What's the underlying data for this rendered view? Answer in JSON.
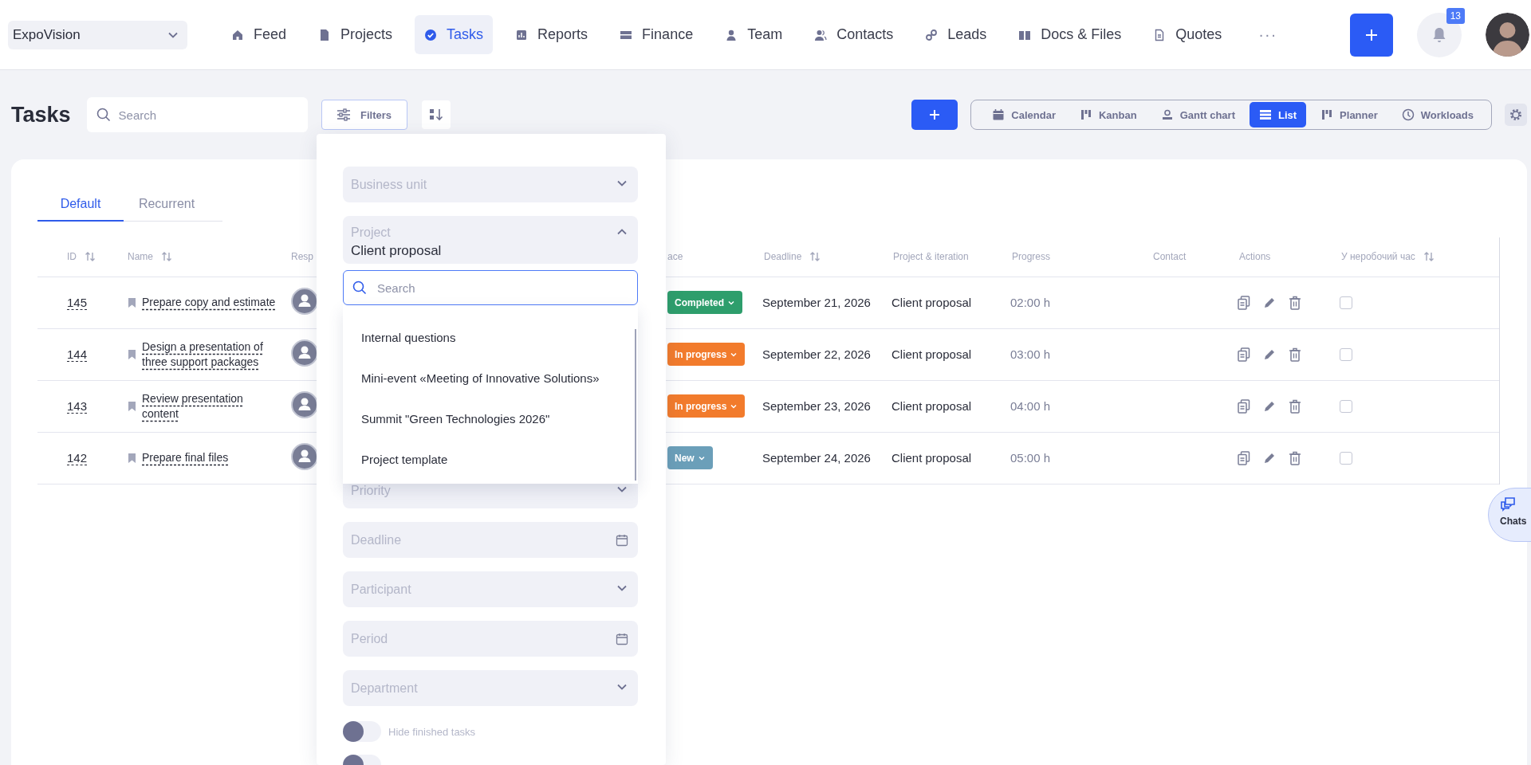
{
  "workspace": {
    "name": "ExpoVision"
  },
  "nav": [
    {
      "label": "Feed",
      "selected": false
    },
    {
      "label": "Projects",
      "selected": false
    },
    {
      "label": "Tasks",
      "selected": true
    },
    {
      "label": "Reports",
      "selected": false
    },
    {
      "label": "Finance",
      "selected": false
    },
    {
      "label": "Team",
      "selected": false
    },
    {
      "label": "Contacts",
      "selected": false
    },
    {
      "label": "Leads",
      "selected": false
    },
    {
      "label": "Docs & Files",
      "selected": false
    },
    {
      "label": "Quotes",
      "selected": false
    }
  ],
  "more": "···",
  "notifications": {
    "count": "13"
  },
  "page": {
    "title": "Tasks",
    "search_placeholder": "Search",
    "filters_label": "Filters"
  },
  "views": [
    {
      "label": "Calendar",
      "selected": false
    },
    {
      "label": "Kanban",
      "selected": false
    },
    {
      "label": "Gantt chart",
      "selected": false
    },
    {
      "label": "List",
      "selected": true
    },
    {
      "label": "Planner",
      "selected": false
    },
    {
      "label": "Workloads",
      "selected": false
    }
  ],
  "tabs": [
    {
      "label": "Default",
      "selected": true
    },
    {
      "label": "Recurrent",
      "selected": false
    }
  ],
  "table": {
    "columns": [
      {
        "label": "ID",
        "sortable": true
      },
      {
        "label": "Name",
        "sortable": true
      },
      {
        "label": "Resp",
        "sortable": false
      },
      {
        "label": "ace",
        "sortable": false
      },
      {
        "label": "Deadline",
        "sortable": true
      },
      {
        "label": "Project & iteration",
        "sortable": false
      },
      {
        "label": "Progress",
        "sortable": false
      },
      {
        "label": "Contact",
        "sortable": false
      },
      {
        "label": "Actions",
        "sortable": false
      },
      {
        "label": "У неробочий час",
        "sortable": true
      }
    ],
    "rows": [
      {
        "id": "145",
        "name": "Prepare copy and estimate",
        "status": {
          "label": "Completed",
          "kind": "completed"
        },
        "deadline": "September 21, 2026",
        "project": "Client proposal",
        "progress": "02:00 h",
        "after_hours": false
      },
      {
        "id": "144",
        "name": "Design a presentation of three support packages",
        "status": {
          "label": "In progress",
          "kind": "in_progress"
        },
        "deadline": "September 22, 2026",
        "project": "Client proposal",
        "progress": "03:00 h",
        "after_hours": false
      },
      {
        "id": "143",
        "name": "Review presentation content",
        "status": {
          "label": "In progress",
          "kind": "in_progress"
        },
        "deadline": "September 23, 2026",
        "project": "Client proposal",
        "progress": "04:00 h",
        "after_hours": false
      },
      {
        "id": "142",
        "name": "Prepare final files",
        "status": {
          "label": "New",
          "kind": "new"
        },
        "deadline": "September 24, 2026",
        "project": "Client proposal",
        "progress": "05:00 h",
        "after_hours": false
      }
    ]
  },
  "filter_panel": {
    "fields": [
      {
        "label": "Business unit",
        "kind": "select",
        "expanded": false
      },
      {
        "label": "Project",
        "kind": "select",
        "value": "Client proposal",
        "expanded": true
      },
      {
        "label": "Priority",
        "kind": "select",
        "expanded": false
      },
      {
        "label": "Deadline",
        "kind": "date"
      },
      {
        "label": "Participant",
        "kind": "select",
        "expanded": false
      },
      {
        "label": "Period",
        "kind": "date"
      },
      {
        "label": "Department",
        "kind": "select",
        "expanded": false
      }
    ],
    "dropdown": {
      "search_placeholder": "Search",
      "options": [
        "Internal questions",
        "Mini-event «Meeting of Innovative Solutions»",
        "Summit \"Green Technologies 2026\"",
        "Project template"
      ]
    },
    "toggles": [
      {
        "label": "Hide finished tasks",
        "on": false
      },
      {
        "on": false
      }
    ]
  },
  "chats": {
    "label": "Chats"
  }
}
